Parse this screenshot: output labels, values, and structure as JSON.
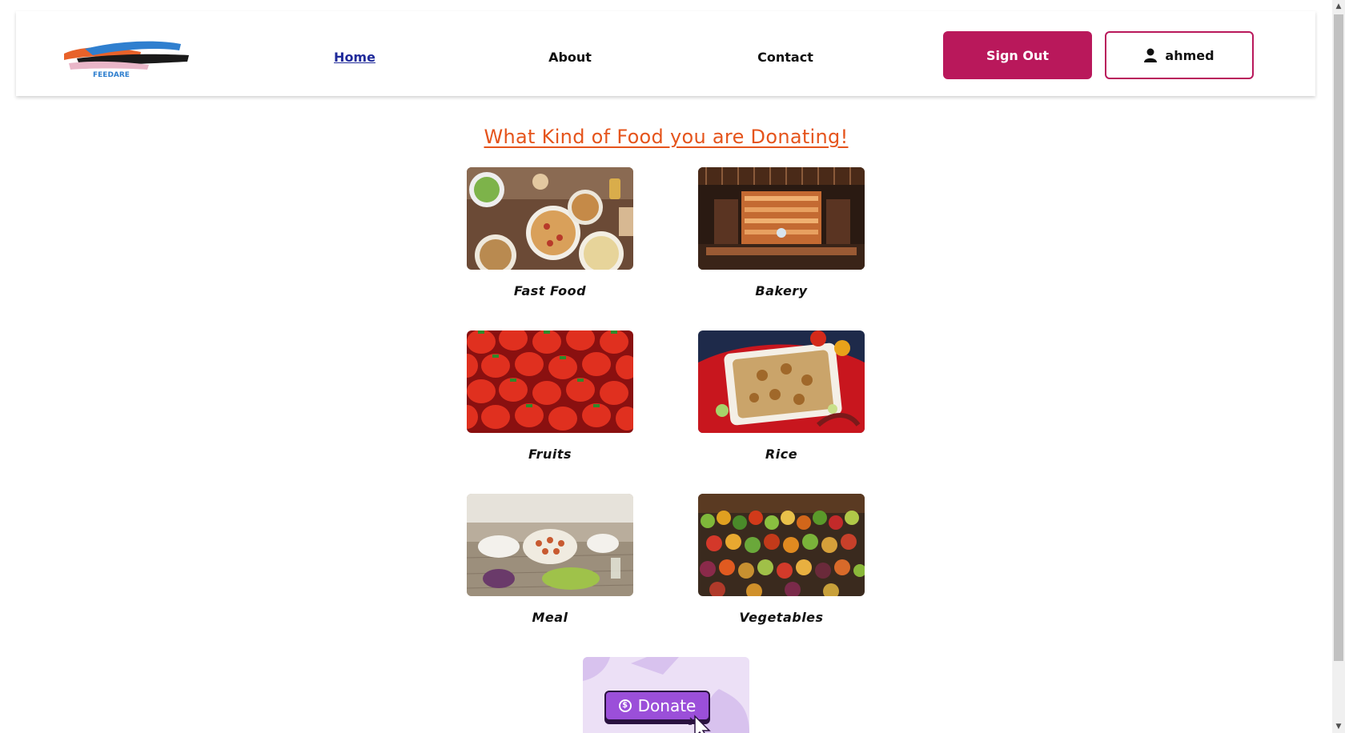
{
  "header": {
    "logo_text": "FEEDARE",
    "nav": [
      {
        "label": "Home",
        "active": true
      },
      {
        "label": "About",
        "active": false
      },
      {
        "label": "Contact",
        "active": false
      }
    ],
    "sign_out_label": "Sign Out",
    "user_label": "ahmed",
    "accent_color": "#b9185b"
  },
  "main": {
    "title": "What Kind of Food you are Donating!",
    "title_color": "#e5541c",
    "categories": [
      {
        "label": "Fast Food",
        "icon": "fast-food-photo"
      },
      {
        "label": "Bakery",
        "icon": "bakery-photo"
      },
      {
        "label": "Fruits",
        "icon": "strawberries-photo"
      },
      {
        "label": "Rice",
        "icon": "rice-photo"
      },
      {
        "label": "Meal",
        "icon": "meal-table-photo"
      },
      {
        "label": "Vegetables",
        "icon": "vegetables-market-photo"
      }
    ],
    "donate_label": "Donate",
    "donate_coin_symbol": "$"
  }
}
